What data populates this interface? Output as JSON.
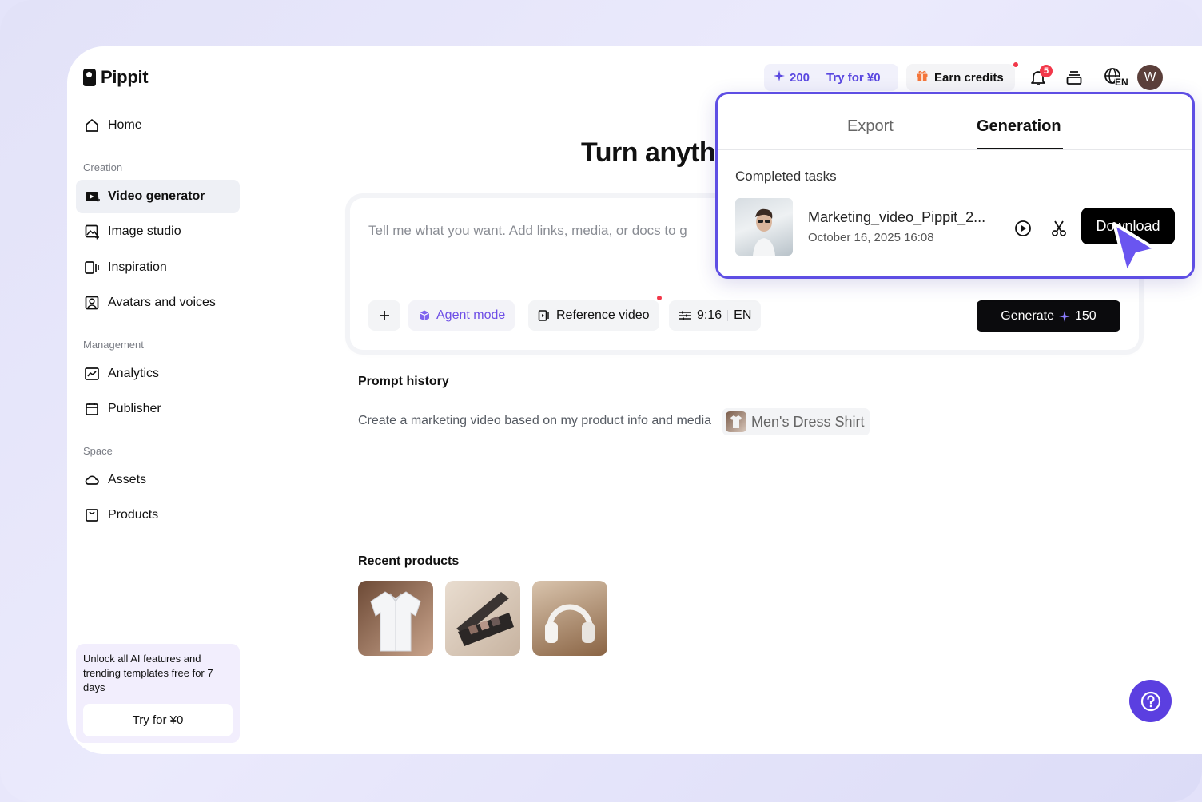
{
  "app": {
    "name": "Pippit"
  },
  "sidebar": {
    "home": "Home",
    "sections": [
      {
        "label": "Creation",
        "items": [
          "Video generator",
          "Image studio",
          "Inspiration",
          "Avatars and voices"
        ]
      },
      {
        "label": "Management",
        "items": [
          "Analytics",
          "Publisher"
        ]
      },
      {
        "label": "Space",
        "items": [
          "Assets",
          "Products"
        ]
      }
    ],
    "active_item": "Video generator",
    "promo": {
      "text": "Unlock all AI features and trending templates free for 7 days",
      "button": "Try for ¥0"
    }
  },
  "topbar": {
    "credits": "200",
    "try_label": "Try for ¥0",
    "earn_label": "Earn credits",
    "notification_count": "5",
    "language": "EN",
    "avatar_initial": "W"
  },
  "main": {
    "headline": "Turn anyth",
    "prompt_placeholder": "Tell me what you want. Add links, media, or docs to g",
    "agent_mode": "Agent mode",
    "reference_video": "Reference video",
    "aspect": "9:16",
    "lang": "EN",
    "generate_label": "Generate",
    "generate_cost": "150",
    "prompt_history_title": "Prompt history",
    "history_text": "Create a marketing video based on my product info and media",
    "history_chip": "Men's Dress Shirt",
    "recent_products_title": "Recent products",
    "products": [
      "shirt",
      "eyeshadow-palette",
      "headphones"
    ]
  },
  "popover": {
    "tabs": [
      "Export",
      "Generation"
    ],
    "active_tab": "Generation",
    "section": "Completed tasks",
    "task": {
      "name": "Marketing_video_Pippit_2...",
      "date": "October 16, 2025 16:08"
    },
    "download": "Download"
  },
  "colors": {
    "accent": "#5e4ee4",
    "button": "#0b0b0d",
    "badge": "#f2384a"
  }
}
